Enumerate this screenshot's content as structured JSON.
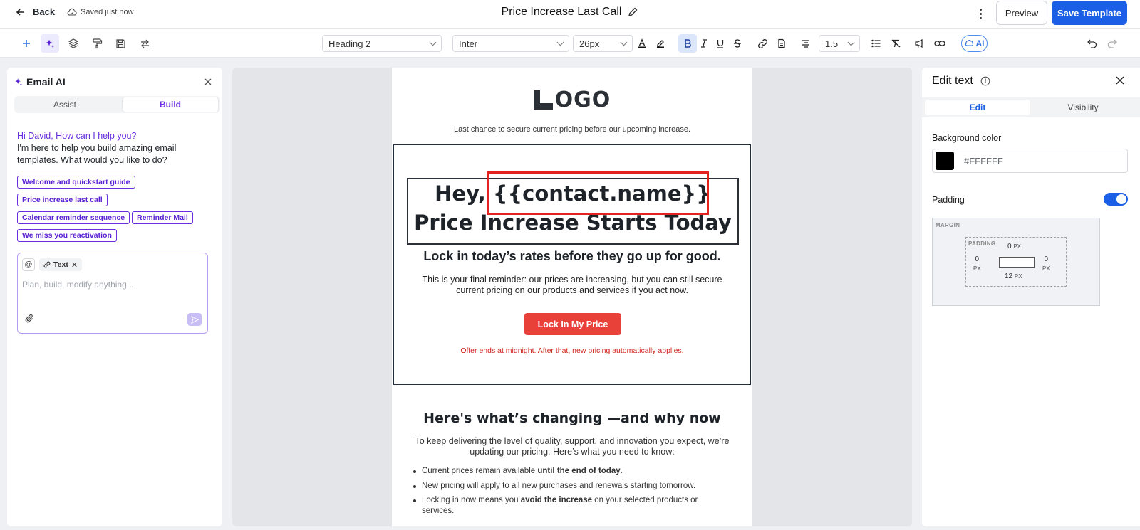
{
  "topbar": {
    "back_label": "Back",
    "saved_status": "Saved just now",
    "title": "Price Increase Last Call",
    "preview_label": "Preview",
    "save_label": "Save Template"
  },
  "toolbar": {
    "block_style": "Heading 2",
    "font_family": "Inter",
    "font_size": "26px",
    "line_height": "1.5",
    "ai_label": "AI"
  },
  "left_panel": {
    "title": "Email AI",
    "tabs": [
      {
        "label": "Assist",
        "selected": false
      },
      {
        "label": "Build",
        "selected": true
      }
    ],
    "greeting": "Hi David, How can I help you?",
    "intro": "I'm here to help you build amazing email templates. What would you like to do?",
    "suggestions": [
      "Welcome and quickstart guide",
      "Price increase last call",
      "Calendar reminder sequence",
      "Reminder Mail",
      "We miss you reactivation"
    ],
    "composer": {
      "at_symbol": "@",
      "context_tag": "Text",
      "placeholder": "Plan, build, modify anything..."
    }
  },
  "email": {
    "logo_text": "OGO",
    "tagline": "Last chance to secure current pricing before our upcoming increase.",
    "headline_line1_prefix": "Hey, ",
    "headline_variable": "{{contact.name}}",
    "headline_line2": "Price Increase Starts Today",
    "subhead": "Lock in today’s rates before they go up for good.",
    "body": "This is your final reminder: our prices are increasing, but you can still secure current pricing on our products and services if you act now.",
    "cta_label": "Lock In My Price",
    "offer_note": "Offer ends at midnight. After that, new pricing automatically applies.",
    "section2_title": "Here's what’s changing —and why now",
    "section2_body": "To keep delivering the level of quality, support, and innovation you expect, we’re updating our pricing. Here’s what you need to know:",
    "bullets": [
      {
        "before": "Current prices remain available ",
        "bold": "until the end of today",
        "after": "."
      },
      {
        "before": "New pricing will apply to all new purchases and renewals starting tomorrow.",
        "bold": "",
        "after": ""
      },
      {
        "before": "Locking in now means you ",
        "bold": "avoid the increase",
        "after": " on your selected products or services."
      }
    ]
  },
  "right_panel": {
    "title": "Edit text",
    "tabs": [
      {
        "label": "Edit",
        "selected": true
      },
      {
        "label": "Visibility",
        "selected": false
      }
    ],
    "background_color_label": "Background color",
    "background_color_value": "#FFFFFF",
    "swatch_color": "#000000",
    "padding_label": "Padding",
    "padding_enabled": true,
    "margin_label": "MARGIN",
    "padding_box_label": "PADDING",
    "padding_values": {
      "top": "0",
      "right": "0",
      "bottom": "12",
      "left": "0",
      "unit": "PX"
    }
  },
  "colors": {
    "primary": "#1a5fe6",
    "ai_purple": "#6a2ee0",
    "cta_red": "#e8413a",
    "highlight_red": "#e3231f",
    "offer_red": "#d0231f"
  }
}
